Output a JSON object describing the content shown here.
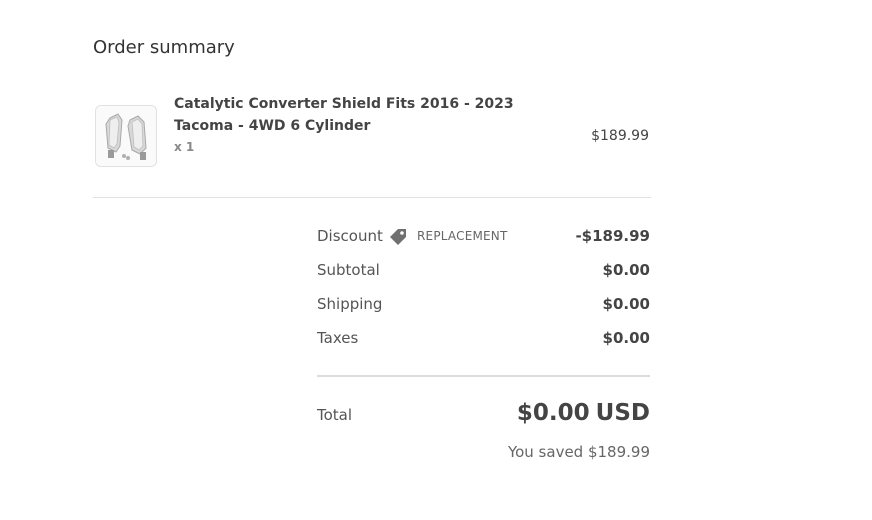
{
  "summary": {
    "heading": "Order summary"
  },
  "product": {
    "title": "Catalytic Converter Shield Fits 2016 - 2023 Tacoma - 4WD 6 Cylinder",
    "quantity": "x 1",
    "price": "$189.99",
    "image_icon": "product-image"
  },
  "costs": {
    "discount": {
      "label": "Discount",
      "code": "REPLACEMENT",
      "icon": "tag-icon",
      "value": "-$189.99"
    },
    "subtotal": {
      "label": "Subtotal",
      "value": "$0.00"
    },
    "shipping": {
      "label": "Shipping",
      "value": "$0.00"
    },
    "taxes": {
      "label": "Taxes",
      "value": "$0.00"
    }
  },
  "total": {
    "label": "Total",
    "amount": "$0.00",
    "currency": "USD",
    "saved": "You saved $189.99"
  },
  "colors": {
    "text": "#333333",
    "muted": "#666666",
    "divider": "#e1e1e1"
  }
}
